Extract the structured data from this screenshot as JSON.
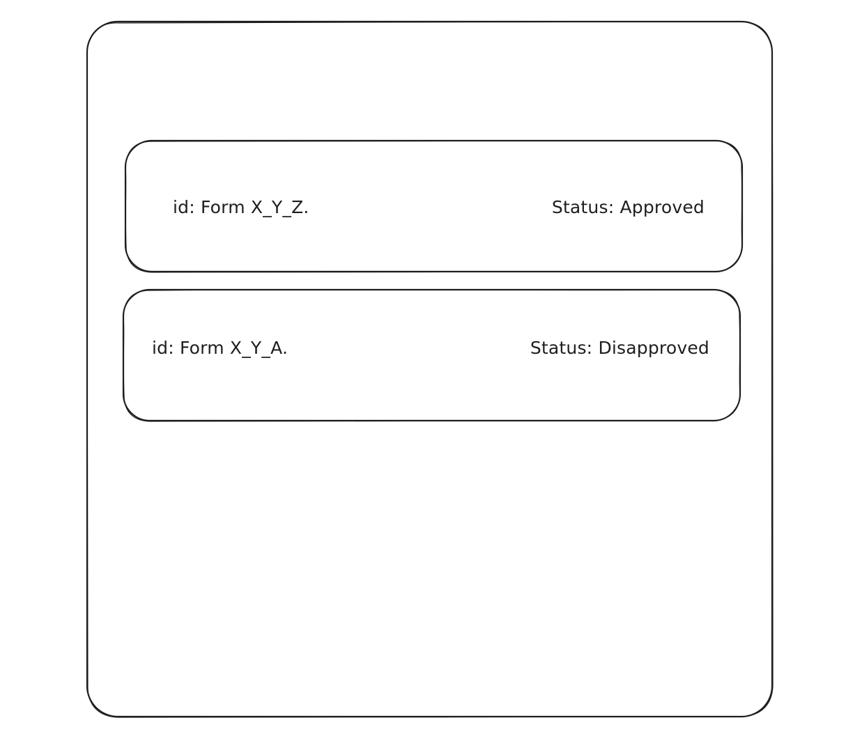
{
  "cards": [
    {
      "id_text": "id: Form X_Y_Z.",
      "status_text": "Status: Approved"
    },
    {
      "id_text": "id: Form X_Y_A.",
      "status_text": "Status: Disapproved"
    }
  ],
  "colors": {
    "stroke": "#1e1e1e",
    "background": "#ffffff"
  }
}
